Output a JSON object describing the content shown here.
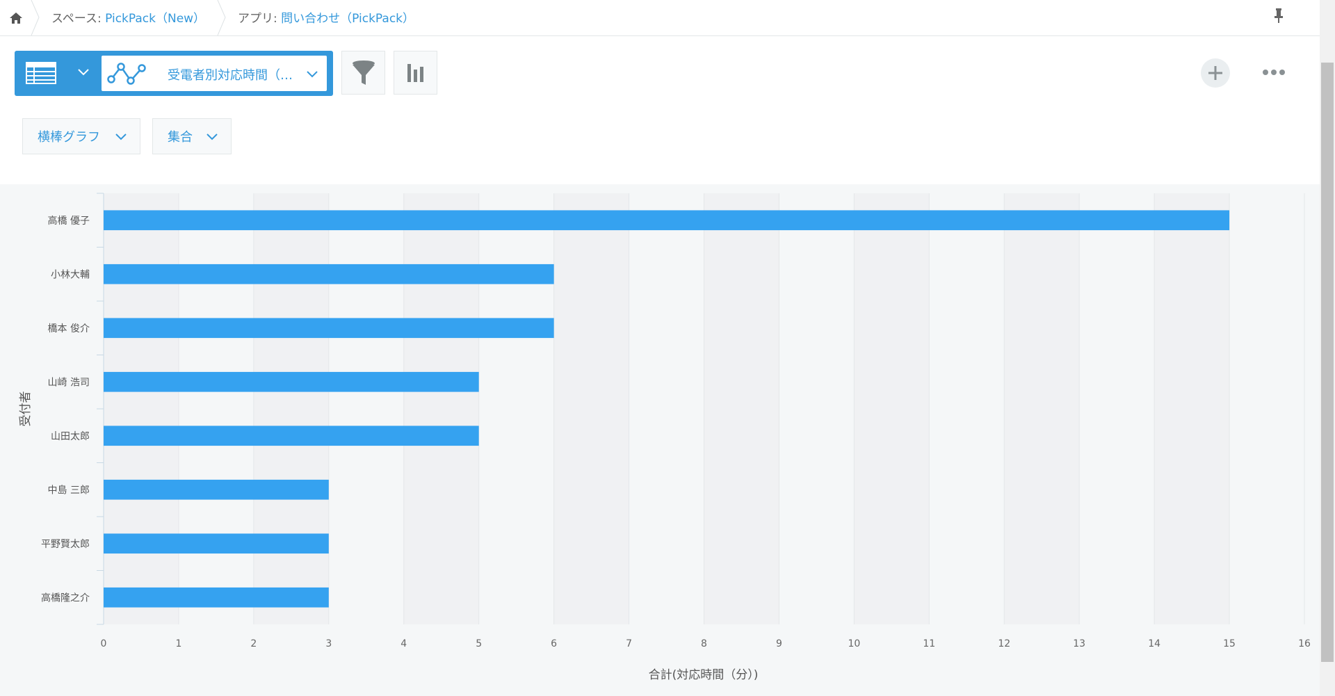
{
  "breadcrumb": {
    "space_label": "スペース:",
    "space_name": "PickPack（New）",
    "app_label": "アプリ:",
    "app_name": "問い合わせ（PickPack）"
  },
  "toolbar": {
    "graph_name": "受電者別対応時間（…"
  },
  "options": {
    "chart_type": "横棒グラフ",
    "aggregation": "集合"
  },
  "colors": {
    "accent": "#3498db",
    "bar": "#35a2f0"
  },
  "chart_data": {
    "type": "bar",
    "orientation": "horizontal",
    "categories": [
      "高橋 優子",
      "小林大輔",
      "橋本 俊介",
      "山崎 浩司",
      "山田太郎",
      "中島 三郎",
      "平野賢太郎",
      "高橋隆之介"
    ],
    "values": [
      15,
      6,
      6,
      5,
      5,
      3,
      3,
      3
    ],
    "xlabel": "合計(対応時間（分）)",
    "ylabel": "受付者",
    "xlim": [
      0,
      16
    ],
    "xticks": [
      "0",
      "1",
      "2",
      "3",
      "4",
      "5",
      "6",
      "7",
      "8",
      "9",
      "10",
      "11",
      "12",
      "13",
      "14",
      "15",
      "16"
    ],
    "grid": "alternating vertical bands"
  }
}
